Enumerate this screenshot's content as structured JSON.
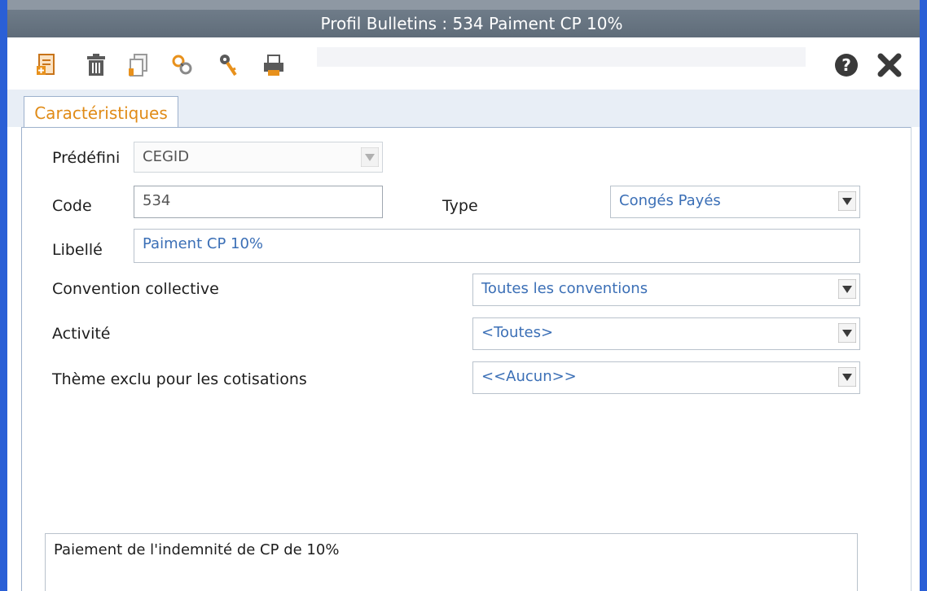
{
  "window": {
    "title": "Profil Bulletins  : 534 Paiment CP 10%"
  },
  "toolbar": {
    "icons": [
      "new-document-icon",
      "trash-icon",
      "duplicate-icon",
      "link-icon",
      "key-icon",
      "print-icon"
    ],
    "help_icon": "question-icon",
    "close_icon": "close-icon"
  },
  "tabs": [
    {
      "label": "Caractéristiques",
      "active": true
    }
  ],
  "form": {
    "predefini": {
      "label": "Prédéfini",
      "value": "CEGID"
    },
    "code": {
      "label": "Code",
      "value": "534"
    },
    "type": {
      "label": "Type",
      "value": "Congés Payés"
    },
    "libelle": {
      "label": "Libellé",
      "value": "Paiment CP 10%"
    },
    "convention": {
      "label": "Convention collective",
      "value": "Toutes les conventions"
    },
    "activite": {
      "label": "Activité",
      "value": "<Toutes>"
    },
    "theme": {
      "label": "Thème exclu pour les cotisations",
      "value": "<<Aucun>>"
    }
  },
  "description": {
    "text": "Paiement de l'indemnité de CP de 10%"
  },
  "colors": {
    "window_border": "#2a5fd6",
    "titlebar": "#6f7c89",
    "tab_text": "#e08b17",
    "icon_orange": "#e8911c",
    "field_text_blue": "#3b6fb6"
  }
}
